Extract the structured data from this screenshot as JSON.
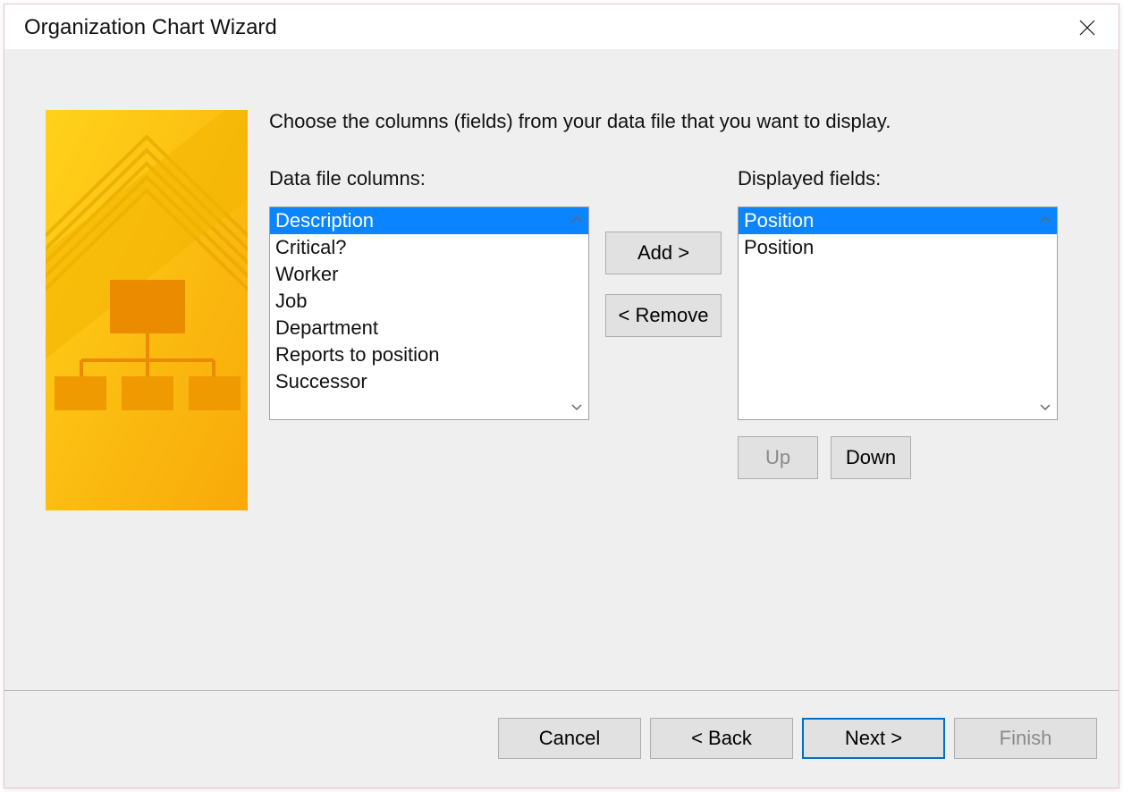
{
  "titlebar": {
    "title": "Organization Chart Wizard"
  },
  "instruction": "Choose the columns (fields) from your data file that you want to display.",
  "labels": {
    "data_file_columns": "Data file columns:",
    "displayed_fields": "Displayed fields:"
  },
  "data_file_columns": {
    "selected": "Description",
    "items": [
      "Description",
      "Critical?",
      "Worker",
      "Job",
      "Department",
      "Reports to position",
      "Successor"
    ]
  },
  "displayed_fields": {
    "selected": "Position",
    "items": [
      "Position",
      "Position"
    ]
  },
  "buttons": {
    "add": "Add >",
    "remove": "< Remove",
    "up": "Up",
    "down": "Down"
  },
  "footer": {
    "cancel": "Cancel",
    "back": "< Back",
    "next": "Next >",
    "finish": "Finish"
  }
}
